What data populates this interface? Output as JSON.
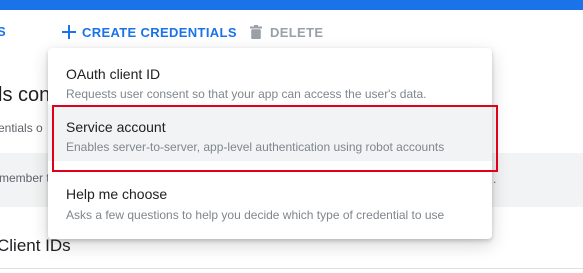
{
  "toolbar": {
    "prev_tab_label": "S",
    "create_label": "CREATE CREDENTIALS",
    "delete_label": "DELETE"
  },
  "page": {
    "heading": "ls con",
    "subtext": "entials o",
    "notice_text": "member t",
    "notice_tail": ".",
    "section_heading": "Client IDs"
  },
  "menu": {
    "items": [
      {
        "title": "OAuth client ID",
        "description": "Requests user consent so that your app can access the user's data."
      },
      {
        "title": "Service account",
        "description": "Enables server-to-server, app-level authentication using robot accounts"
      },
      {
        "title": "Help me choose",
        "description": "Asks a few questions to help you decide which type of credential to use"
      }
    ]
  },
  "colors": {
    "accent": "#1a73e8",
    "highlight_border": "#e0001b",
    "disabled_text": "#9aa0a6"
  }
}
